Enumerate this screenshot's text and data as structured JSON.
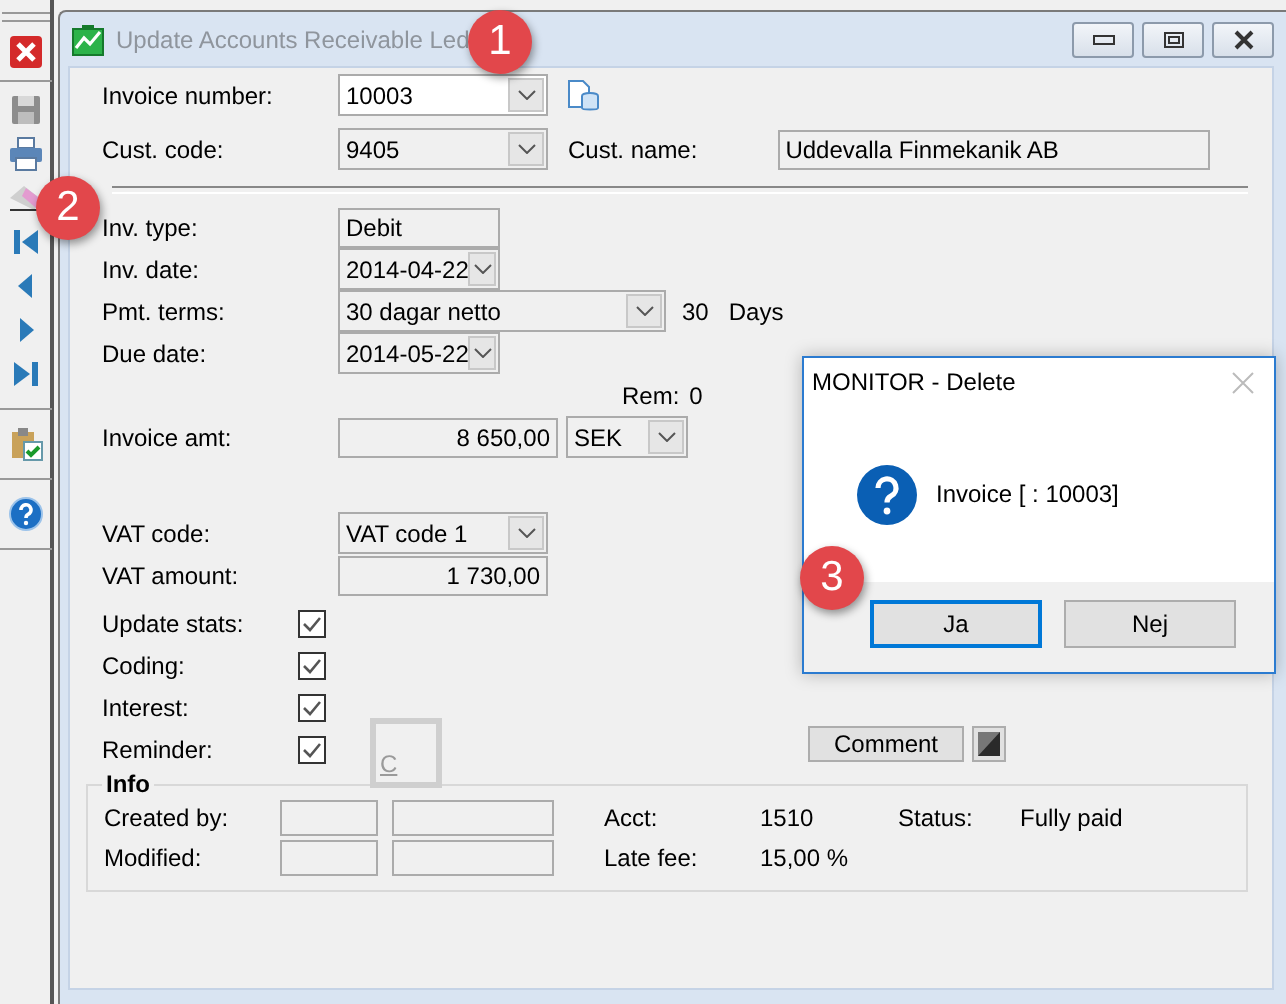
{
  "window": {
    "title": "Update Accounts Receivable Led"
  },
  "invoice_number": {
    "label": "Invoice number:",
    "value": "10003"
  },
  "customer": {
    "code_label": "Cust. code:",
    "code": "9405",
    "name_label": "Cust. name:",
    "name": "Uddevalla Finmekanik AB"
  },
  "fields": [
    {
      "kind": "text",
      "label": "Inv. type:",
      "value": "Debit"
    },
    {
      "kind": "combo",
      "label": "Inv. date:",
      "value": "2014-04-22"
    },
    {
      "kind": "terms",
      "label": "Pmt. terms:",
      "value": "30 dagar netto",
      "days": "30",
      "unit": "Days"
    },
    {
      "kind": "combo",
      "label": "Due date:",
      "value": "2014-05-22"
    }
  ],
  "remaining": {
    "label": "Rem:",
    "value": "0"
  },
  "amount": {
    "label": "Invoice amt:",
    "value": "8 650,00",
    "currency": "SEK"
  },
  "vat": {
    "code_label": "VAT code:",
    "code": "VAT code 1",
    "amount_label": "VAT amount:",
    "amount": "1 730,00"
  },
  "options": [
    {
      "label": "Update stats:",
      "checked": true
    },
    {
      "label": "Coding:",
      "checked": true
    },
    {
      "label": "Interest:",
      "checked": true
    },
    {
      "label": "Reminder:",
      "checked": true
    }
  ],
  "c_button": {
    "label": "C",
    "disabled": true
  },
  "comment_button": "Comment",
  "info": {
    "title": "Info",
    "created_by_label": "Created by:",
    "modified_label": "Modified:",
    "acct_label": "Acct:",
    "acct": "1510",
    "late_fee_label": "Late fee:",
    "late_fee": "15,00 %",
    "status_label": "Status:",
    "status": "Fully paid"
  },
  "dialog": {
    "title": "MONITOR - Delete",
    "message": "Invoice [ : 10003]",
    "buttons": [
      {
        "label": "Ja",
        "focused": true
      },
      {
        "label": "Nej",
        "focused": false
      }
    ]
  },
  "callouts": [
    "1",
    "2",
    "3"
  ]
}
